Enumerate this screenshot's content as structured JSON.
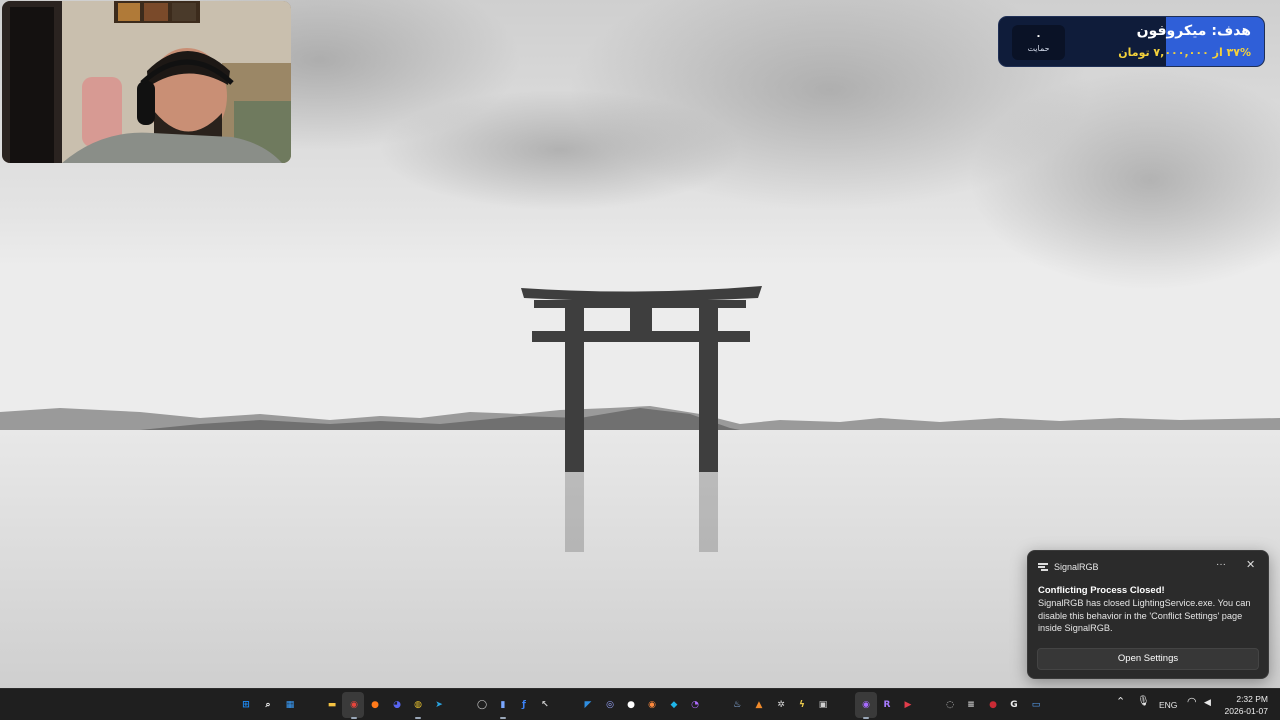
{
  "goal_widget": {
    "title": "هدف: میکروفون",
    "progress_text": "۳۷% از ۷,۰۰۰,۰۰۰ تومان",
    "progress_fraction": 0.37,
    "supporter_count": "۰",
    "supporter_label": "حمایت",
    "accent": "#2f5fd8",
    "progress_text_color": "#f3d13c"
  },
  "notification": {
    "app_name": "SignalRGB",
    "more_glyph": "···",
    "close_glyph": "✕",
    "title": "Conflicting Process Closed!",
    "body": "SignalRGB has closed LightingService.exe. You can disable this behavior in the 'Conflict Settings' page inside SignalRGB.",
    "button_label": "Open Settings"
  },
  "taskbar": {
    "apps": [
      {
        "name": "start",
        "glyph": "⊞",
        "color": "#1e90ff"
      },
      {
        "name": "search",
        "glyph": "⌕",
        "color": "#ffffff"
      },
      {
        "name": "widgets",
        "glyph": "▦",
        "color": "#3aa0ff"
      },
      {
        "name": "file-explorer",
        "glyph": "▬",
        "color": "#f5c342"
      },
      {
        "name": "chrome",
        "glyph": "◉",
        "color": "#e8453c"
      },
      {
        "name": "firefox",
        "glyph": "●",
        "color": "#ff7a1a"
      },
      {
        "name": "discord",
        "glyph": "◕",
        "color": "#5865f2"
      },
      {
        "name": "app-yellow",
        "glyph": "◍",
        "color": "#e8c22f"
      },
      {
        "name": "telegram",
        "glyph": "➤",
        "color": "#2aa3e0"
      },
      {
        "name": "app-circle",
        "glyph": "◯",
        "color": "#d0d0d0"
      },
      {
        "name": "stats",
        "glyph": "▮",
        "color": "#7aa7ff"
      },
      {
        "name": "app-script",
        "glyph": "ƒ",
        "color": "#3b82f6"
      },
      {
        "name": "cursor",
        "glyph": "↖",
        "color": "#cfcfcf"
      },
      {
        "name": "vscode",
        "glyph": "◤",
        "color": "#2f8ee0"
      },
      {
        "name": "app-eye",
        "glyph": "◎",
        "color": "#9aa7ff"
      },
      {
        "name": "app-dark",
        "glyph": "●",
        "color": "#ffffff"
      },
      {
        "name": "app-orange",
        "glyph": "◉",
        "color": "#ff8a3d"
      },
      {
        "name": "app-blue",
        "glyph": "◆",
        "color": "#1fb5e8"
      },
      {
        "name": "app-purple",
        "glyph": "◔",
        "color": "#b06cff"
      },
      {
        "name": "steam",
        "glyph": "♨",
        "color": "#9cc7ff"
      },
      {
        "name": "app-warning",
        "glyph": "▲",
        "color": "#f08a2b"
      },
      {
        "name": "app-gear",
        "glyph": "✲",
        "color": "#d8d8d8"
      },
      {
        "name": "app-lightning",
        "glyph": "ϟ",
        "color": "#e9c84c"
      },
      {
        "name": "app-dg",
        "glyph": "▣",
        "color": "#cfcfcf"
      },
      {
        "name": "obs",
        "glyph": "◉",
        "color": "#a86bff"
      },
      {
        "name": "app-r",
        "glyph": "R",
        "color": "#a77bff"
      },
      {
        "name": "app-red",
        "glyph": "▶",
        "color": "#e23d4b"
      }
    ],
    "tray": [
      {
        "name": "tray-app-1",
        "glyph": "◌",
        "color": "#cccccc"
      },
      {
        "name": "tray-signalrgb",
        "glyph": "≡",
        "color": "#dddddd"
      },
      {
        "name": "tray-red",
        "glyph": "●",
        "color": "#c92b35"
      },
      {
        "name": "tray-g",
        "glyph": "G",
        "color": "#eeeeee"
      },
      {
        "name": "tray-monitor",
        "glyph": "▭",
        "color": "#5aa8ff"
      }
    ],
    "chevron": "⌃",
    "mic": "🎙",
    "language": "ENG",
    "wifi": "◠",
    "volume": "◀",
    "time": "2:32 PM",
    "date": "2026-01-07"
  }
}
